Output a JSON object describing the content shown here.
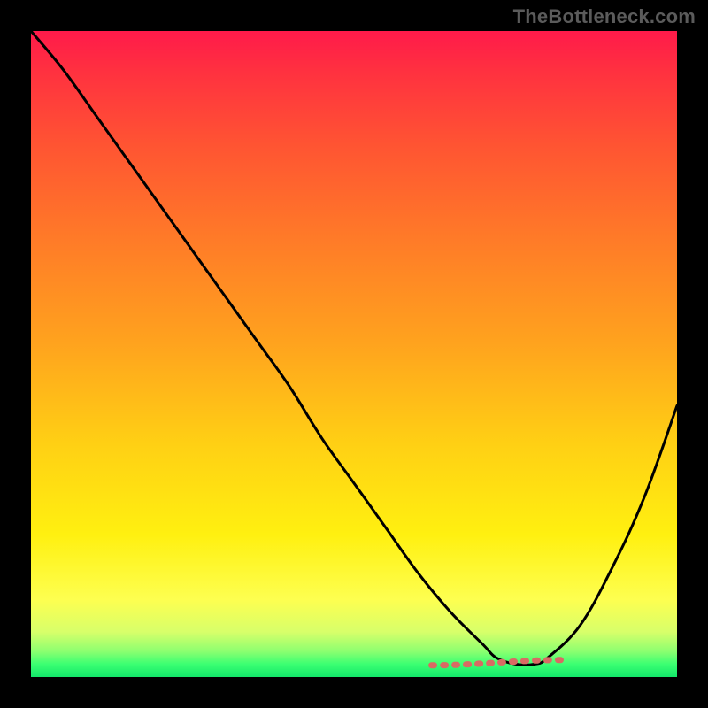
{
  "watermark": "TheBottleneck.com",
  "colors": {
    "background": "#000000",
    "curve": "#000000",
    "dash": "#d96a63",
    "watermark": "#5b5b5b",
    "gradient_stops": [
      "#ff1a4a",
      "#ff3040",
      "#ff5532",
      "#ff7a28",
      "#ffa21e",
      "#ffd014",
      "#fff010",
      "#fdff50",
      "#d8ff6a",
      "#8dff70",
      "#3bff72",
      "#13e86a"
    ]
  },
  "chart_data": {
    "type": "line",
    "title": "",
    "xlabel": "",
    "ylabel": "",
    "xlim": [
      0,
      100
    ],
    "ylim": [
      0,
      100
    ],
    "x": [
      0,
      5,
      10,
      15,
      20,
      25,
      30,
      35,
      40,
      45,
      50,
      55,
      60,
      65,
      70,
      72,
      75,
      78,
      80,
      85,
      90,
      95,
      100
    ],
    "y": [
      100,
      94,
      87,
      80,
      73,
      66,
      59,
      52,
      45,
      37,
      30,
      23,
      16,
      10,
      5,
      3,
      2,
      2,
      3,
      8,
      17,
      28,
      42
    ],
    "note": "y is bottleneck percentage (visual height). Curve dips to ~2% near x≈76 then rises.",
    "dash_segment": {
      "x_start": 62,
      "x_end": 82,
      "y": 2.5
    }
  }
}
